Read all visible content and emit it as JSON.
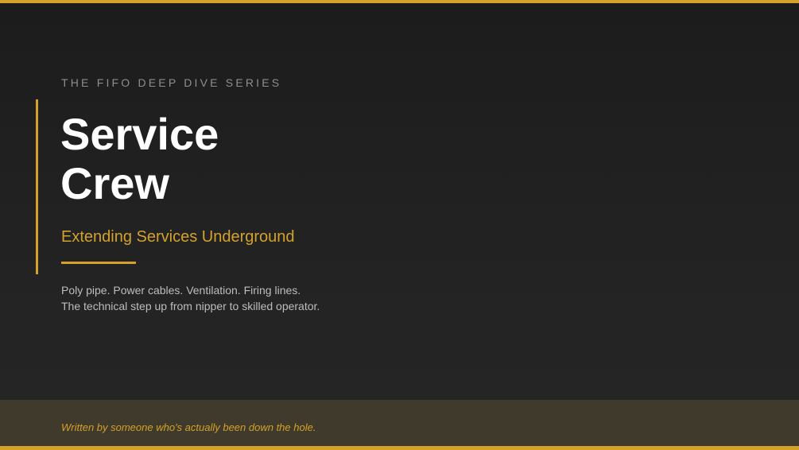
{
  "series_label": "THE FIFO DEEP DIVE SERIES",
  "title": {
    "line1": "Service",
    "line2": "Crew"
  },
  "subtitle": "Extending Services Underground",
  "description": {
    "line1": "Poly pipe. Power cables. Ventilation. Firing lines.",
    "line2": "The technical step up from nipper to skilled operator."
  },
  "footer": {
    "text": "Written by someone who's actually been down the hole."
  },
  "colors": {
    "accent": "#d4a12a",
    "background": "#1f1f1f",
    "footer_band": "#3f3a2b"
  }
}
